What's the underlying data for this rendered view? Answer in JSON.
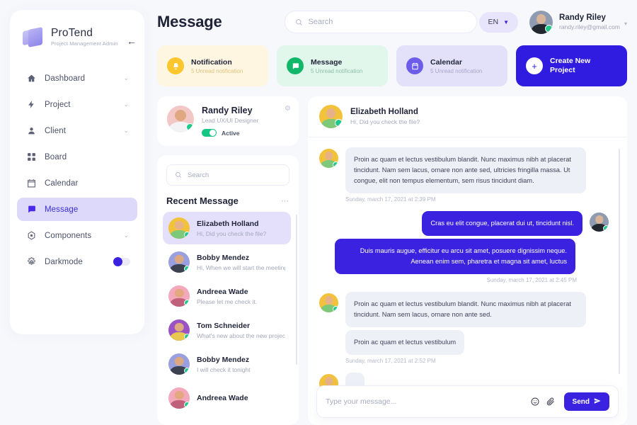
{
  "brand": {
    "title": "ProTend",
    "subtitle": "Project Management Admin",
    "collapse_icon": "arrow-left-icon"
  },
  "sidebar": {
    "items": [
      {
        "label": "Dashboard",
        "icon": "home-icon",
        "caret": "⌄",
        "active": false
      },
      {
        "label": "Project",
        "icon": "bolt-icon",
        "caret": "⌄",
        "active": false
      },
      {
        "label": "Client",
        "icon": "user-icon",
        "caret": "⌄",
        "active": false
      },
      {
        "label": "Board",
        "icon": "grid-icon",
        "caret": "",
        "active": false
      },
      {
        "label": "Calendar",
        "icon": "calendar-icon",
        "caret": "",
        "active": false
      },
      {
        "label": "Message",
        "icon": "chat-icon",
        "caret": "",
        "active": true
      },
      {
        "label": "Components",
        "icon": "components-icon",
        "caret": "⌄",
        "active": false
      },
      {
        "label": "Darkmode",
        "icon": "gear-icon",
        "caret": "",
        "active": false,
        "toggle": "off"
      }
    ]
  },
  "header": {
    "page_title": "Message",
    "search": {
      "value": "",
      "placeholder": "Search",
      "icon": "search-icon"
    },
    "language": {
      "label": "EN",
      "caret": "▼"
    },
    "user": {
      "name": "Randy Riley",
      "email": "randy.riley@gmail.com",
      "caret": "▾",
      "status": "online"
    }
  },
  "stats": [
    {
      "title": "Notification",
      "subtitle": "5 Unread notification",
      "icon": "bell-icon",
      "kind": "notification"
    },
    {
      "title": "Message",
      "subtitle": "5 Unread notification",
      "icon": "chat-icon",
      "kind": "message"
    },
    {
      "title": "Calendar",
      "subtitle": "5 Unread notification",
      "icon": "calendar-icon",
      "kind": "calendar"
    },
    {
      "title": "Create New Project",
      "subtitle": "",
      "icon": "plus-icon",
      "kind": "cta"
    }
  ],
  "profile": {
    "name": "Randy Riley",
    "role": "Lead UX/UI Designer",
    "status_label": "Active",
    "status_toggle": "on",
    "settings_icon": "gear-icon"
  },
  "conversations": {
    "search": {
      "value": "",
      "placeholder": "Search",
      "icon": "search-icon"
    },
    "title": "Recent Message",
    "more_icon": "ellipsis-icon",
    "items": [
      {
        "name": "Elizabeth Holland",
        "preview": "Hi, Did you check the file?",
        "selected": true
      },
      {
        "name": "Bobby Mendez",
        "preview": "Hi, When we will start the meeting?",
        "selected": false
      },
      {
        "name": "Andreea Wade",
        "preview": "Please let me check it.",
        "selected": false
      },
      {
        "name": "Tom Schneider",
        "preview": "What's new about the new project?",
        "selected": false
      },
      {
        "name": "Bobby Mendez",
        "preview": "I will check it tonight",
        "selected": false
      },
      {
        "name": "Andreea Wade",
        "preview": "",
        "selected": false
      }
    ]
  },
  "chat": {
    "header": {
      "name": "Elizabeth Holland",
      "subtitle": "Hi, Did you check the file?"
    },
    "messages": [
      {
        "dir": "in",
        "text": "Proin ac quam et lectus vestibulum blandit. Nunc maximus nibh at placerat tincidunt. Nam sem lacus, ornare non ante sed, ultricies fringilla massa. Ut congue, elit non tempus elementum, sem risus tincidunt diam."
      },
      {
        "dir": "stamp",
        "text": "Sunday, march 17, 2021 at 2:39 PM"
      },
      {
        "dir": "out",
        "text": "Cras eu elit congue, placerat dui ut, tincidunt nisl."
      },
      {
        "dir": "out",
        "text": "Duis mauris augue, efficitur eu arcu sit amet, posuere dignissim neque. Aenean enim sem, pharetra et magna sit amet, luctus"
      },
      {
        "dir": "stamp-right",
        "text": "Sunday, march 17, 2021 at 2:45 PM"
      },
      {
        "dir": "in",
        "text": "Proin ac quam et lectus vestibulum blandit. Nunc maximus nibh at placerat tincidunt. Nam sem lacus, ornare non ante sed."
      },
      {
        "dir": "in-cont",
        "text": "Proin ac quam et lectus vestibulum"
      },
      {
        "dir": "stamp",
        "text": "Sunday, march 17, 2021 at 2:52 PM"
      }
    ],
    "composer": {
      "value": "",
      "placeholder": "Type your message...",
      "emoji_icon": "emoji-icon",
      "attach_icon": "paperclip-icon",
      "send_label": "Send",
      "send_icon": "paper-plane-icon"
    }
  },
  "colors": {
    "accent": "#3a22e0",
    "accent_soft": "#ddd9fb",
    "page_bg": "#f7f8fc",
    "notification": "#fcc62e",
    "message": "#12b76a",
    "calendar": "#6c5ce9",
    "online": "#1fc98b"
  }
}
